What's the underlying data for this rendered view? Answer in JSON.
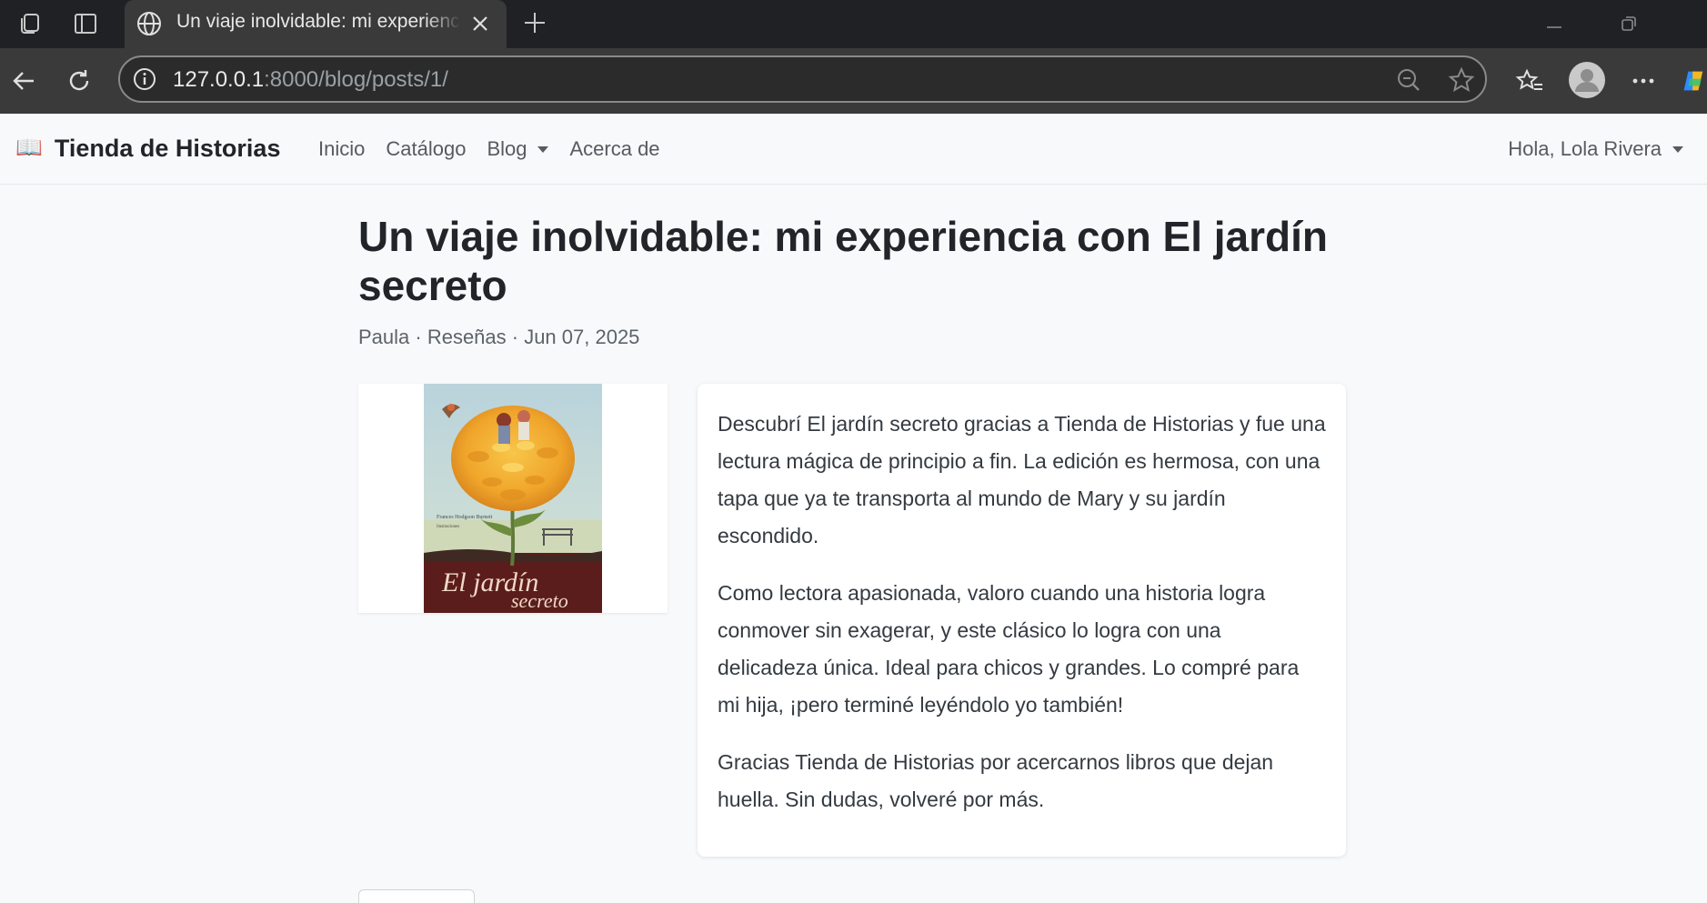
{
  "browser": {
    "tab_title": "Un viaje inolvidable: mi experiencia con El jardín secreto",
    "url_host": "127.0.0.1",
    "url_rest": ":8000/blog/posts/1/"
  },
  "navbar": {
    "brand_icon": "📖",
    "brand": "Tienda de Historias",
    "links": [
      "Inicio",
      "Catálogo",
      "Blog",
      "Acerca de"
    ],
    "user": "Hola, Lola Rivera"
  },
  "post": {
    "title": "Un viaje inolvidable: mi experiencia con El jardín secreto",
    "meta": "Paula · Reseñas · Jun 07, 2025",
    "paragraphs": [
      "Descubrí El jardín secreto gracias a Tienda de Historias y fue una lectura mágica de principio a fin. La edición es hermosa, con una tapa que ya te transporta al mundo de Mary y su jardín escondido.",
      "Como lectora apasionada, valoro cuando una historia logra conmover sin exagerar, y este clásico lo logra con una delicadeza única. Ideal para chicos y grandes. Lo compré para mi hija, ¡pero terminé leyéndolo yo también!",
      "Gracias Tienda de Historias por acercarnos libros que dejan huella. Sin dudas, volveré por más."
    ]
  },
  "colors": {
    "chrome_dark": "#202124",
    "chrome_bar": "#3a3a3a",
    "page_bg": "#f8f9fa",
    "text_dark": "#212529"
  }
}
